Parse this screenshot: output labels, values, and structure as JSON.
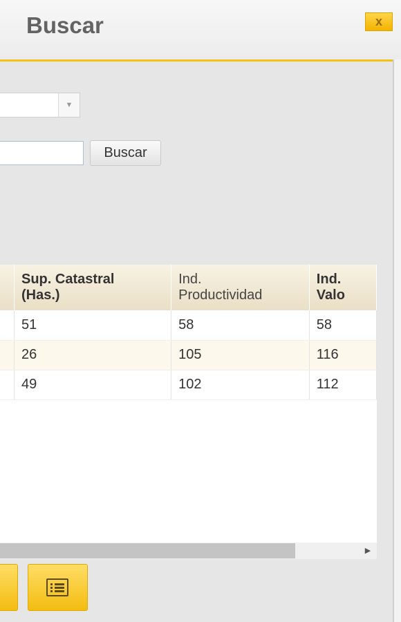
{
  "dialog": {
    "title": "Buscar",
    "close_label": "x"
  },
  "search": {
    "button_label": "Buscar",
    "input_value": "",
    "select_value": ""
  },
  "grid": {
    "columns": [
      {
        "line1": "Sup. Catastral",
        "line2": "(Has.)"
      },
      {
        "line1": "Ind.",
        "line2": "Productividad"
      },
      {
        "line1": "Ind. Valo",
        "line2": ""
      }
    ],
    "rows": [
      [
        "51",
        "58",
        "58"
      ],
      [
        "26",
        "105",
        "116"
      ],
      [
        "49",
        "102",
        "112"
      ]
    ]
  },
  "colors": {
    "accent": "#f3c213",
    "button_yellow": "#f3bc10"
  },
  "icons": {
    "close": "close-icon",
    "dropdown": "chevron-down-icon",
    "list": "list-icon",
    "scroll": "scroll-right-arrow-icon"
  }
}
